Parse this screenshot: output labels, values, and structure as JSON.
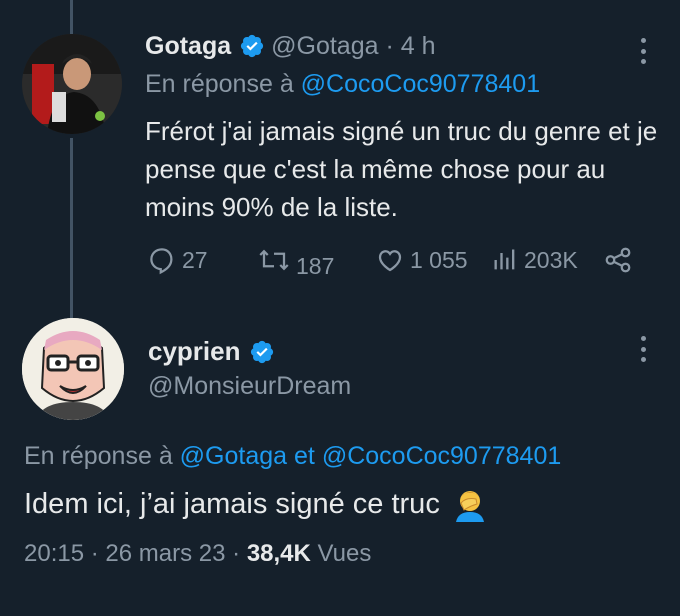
{
  "tweet1": {
    "name": "Gotaga",
    "handle": "@Gotaga",
    "time": "4 h",
    "reply_prefix": "En réponse à",
    "reply_to": "@CocoCoc90778401",
    "text": "Frérot j'ai jamais signé un truc du genre et je pense que c'est la même chose pour au moins 90% de la liste.",
    "replies": "27",
    "retweets": "187",
    "likes": "1 055",
    "views": "203K"
  },
  "tweet2": {
    "name": "cyprien",
    "handle": "@MonsieurDream",
    "reply_prefix": "En réponse à",
    "reply_to_1": "@Gotaga",
    "reply_joiner": "et",
    "reply_to_2": "@CocoCoc90778401",
    "text": "Idem ici, j’ai jamais signé ce truc",
    "time": "20:15",
    "date": "26 mars 23",
    "views_count": "38,4K",
    "views_label": "Vues"
  },
  "colors": {
    "background": "#15202b",
    "link": "#1d9bf0",
    "muted": "#8b98a5",
    "text": "#e7e9ea"
  },
  "icons": [
    "verified-badge-icon",
    "reply-icon",
    "retweet-icon",
    "like-icon",
    "views-icon",
    "share-icon",
    "more-icon",
    "facepalm-emoji"
  ]
}
